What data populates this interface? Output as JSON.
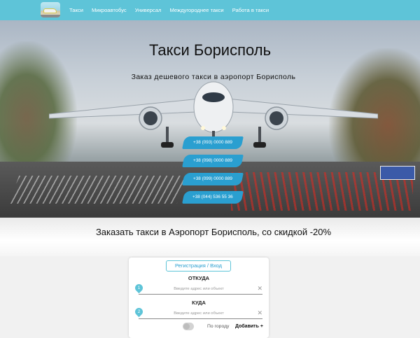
{
  "nav": {
    "items": [
      "Такси",
      "Микроавтобус",
      "Универсал",
      "Междугороднее такси",
      "Работа в такси"
    ]
  },
  "hero": {
    "title": "Такси Борисполь",
    "subtitle": "Заказ дешевого такси в аэропорт Борисполь",
    "phones": [
      "+38 (093) 0000 889",
      "+38 (098) 0000 889",
      "+38 (099) 0000 889",
      "+38 (044) 536 55 36"
    ]
  },
  "promo": {
    "text": "Заказать такси в Аэропорт Борисполь, со скидкой -20%"
  },
  "form": {
    "auth_label": "Регистрация / Вход",
    "from_label": "ОТКУДА",
    "to_label": "КУДА",
    "from_placeholder": "Введите адрес или объект",
    "to_placeholder": "Введите адрес или объект",
    "pin1": "1",
    "pin2": "2",
    "clear": "✕",
    "by_city_label": "По городу",
    "add_label": "Добавить +"
  },
  "colors": {
    "nav_bg": "#5ec4d8",
    "phone_bg": "#2a9fd0"
  }
}
